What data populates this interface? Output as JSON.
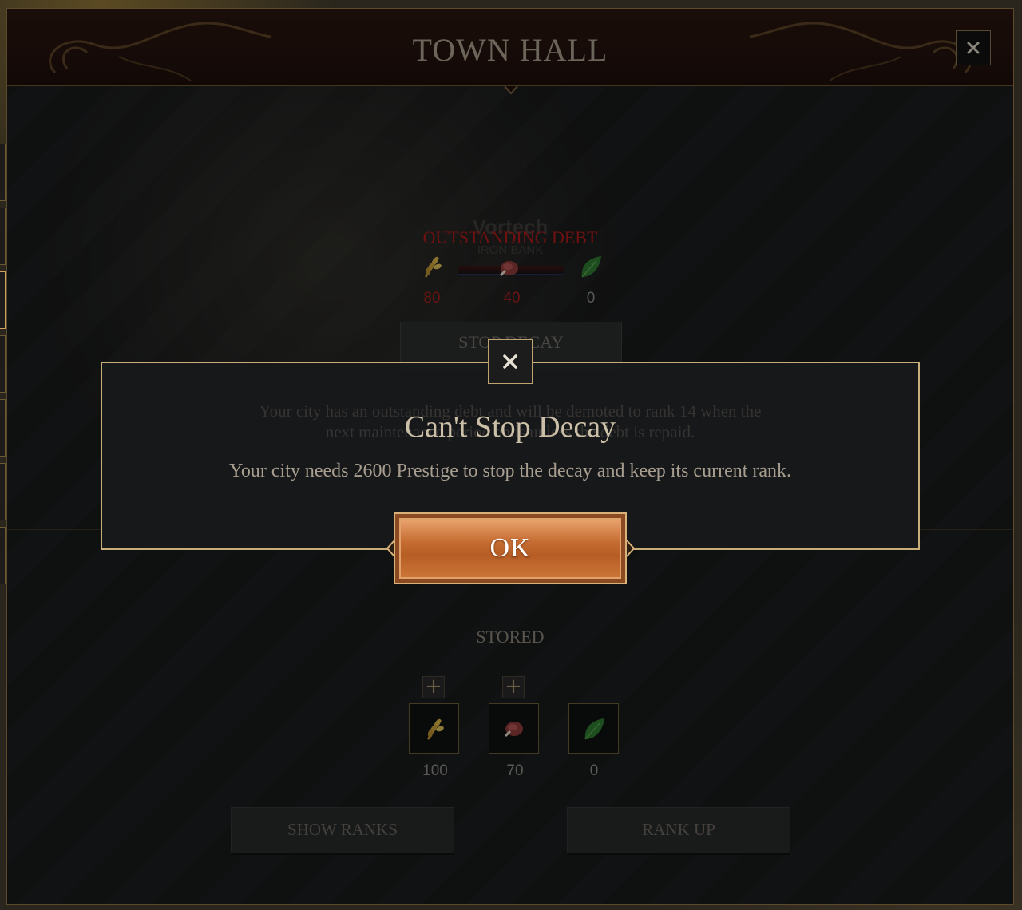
{
  "window": {
    "title": "TOWN HALL"
  },
  "city": {
    "name": "Vortech",
    "bank": "IRON BANK"
  },
  "debt": {
    "title": "OUTSTANDING DEBT",
    "items": [
      {
        "icon": "wheat-icon",
        "value": "80"
      },
      {
        "icon": "meat-icon",
        "value": "40"
      },
      {
        "icon": "leaf-icon",
        "value": "0"
      }
    ],
    "stop_decay_label": "STOP DECAY",
    "ghost_text_line1": "Your city has an outstanding debt and will be demoted to rank 14 when the",
    "ghost_text_line2": "next maintenance period ends unless the debt is repaid."
  },
  "stored": {
    "label": "STORED",
    "items": [
      {
        "icon": "wheat-icon",
        "value": "100"
      },
      {
        "icon": "meat-icon",
        "value": "70"
      },
      {
        "icon": "leaf-icon",
        "value": "0"
      }
    ]
  },
  "actions": {
    "show_ranks": "SHOW RANKS",
    "rank_up": "RANK UP"
  },
  "modal": {
    "title": "Can't Stop Decay",
    "message": "Your city needs 2600 Prestige to stop the decay and keep its current rank.",
    "ok_label": "OK"
  },
  "colors": {
    "accent_gold": "#c9ae7a",
    "debt_red": "#b01c1c",
    "ok_orange": "#c66d33"
  }
}
